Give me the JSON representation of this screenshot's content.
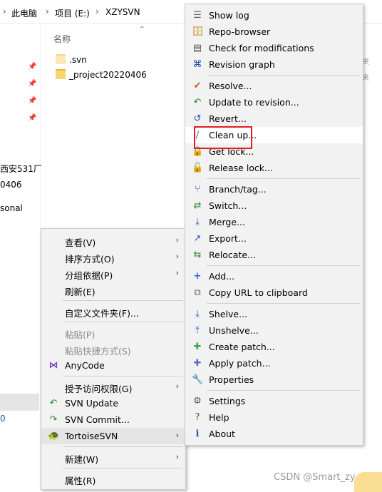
{
  "breadcrumb": [
    "此电脑",
    "项目 (E:)",
    "XZYSVN"
  ],
  "breadcrumb_sep": "›",
  "sidebar": {
    "texts": [
      "西安531厂",
      "0406",
      "sonal",
      "0"
    ],
    "pin_icon": "pin-icon"
  },
  "content": {
    "column_header": "名称",
    "files": [
      ".svn",
      "_project20220406"
    ],
    "right_stubs": [
      "夹",
      "夹"
    ]
  },
  "explorer_menu": {
    "items": [
      {
        "label": "查看(V)",
        "arrow": "›"
      },
      {
        "label": "排序方式(O)",
        "arrow": "›"
      },
      {
        "label": "分组依据(P)",
        "arrow": "›"
      },
      {
        "label": "刷新(E)"
      },
      {
        "label": "自定义文件夹(F)..."
      },
      {
        "label": "粘贴(P)",
        "disabled": true
      },
      {
        "label": "粘贴快捷方式(S)",
        "disabled": true
      },
      {
        "label": "AnyCode",
        "icon": "visual-studio-icon"
      },
      {
        "label": "授予访问权限(G)",
        "arrow": "›"
      },
      {
        "label": "SVN Update",
        "icon": "svn-update-icon"
      },
      {
        "label": "SVN Commit...",
        "icon": "svn-commit-icon"
      },
      {
        "label": "TortoiseSVN",
        "icon": "tortoise-icon",
        "arrow": "›"
      },
      {
        "label": "新建(W)",
        "arrow": "›"
      },
      {
        "label": "属性(R)"
      }
    ]
  },
  "tortoise_menu": {
    "items": [
      {
        "label": "Show log",
        "icon": "log-icon"
      },
      {
        "label": "Repo-browser",
        "icon": "repo-browser-icon"
      },
      {
        "label": "Check for modifications",
        "icon": "check-modifications-icon"
      },
      {
        "label": "Revision graph",
        "icon": "revision-graph-icon"
      },
      {
        "label": "Resolve...",
        "icon": "resolve-icon"
      },
      {
        "label": "Update to revision...",
        "icon": "update-revision-icon"
      },
      {
        "label": "Revert...",
        "icon": "revert-icon"
      },
      {
        "label": "Clean up...",
        "icon": "cleanup-icon"
      },
      {
        "label": "Get lock...",
        "icon": "get-lock-icon"
      },
      {
        "label": "Release lock...",
        "icon": "release-lock-icon"
      },
      {
        "label": "Branch/tag...",
        "icon": "branch-icon"
      },
      {
        "label": "Switch...",
        "icon": "switch-icon"
      },
      {
        "label": "Merge...",
        "icon": "merge-icon"
      },
      {
        "label": "Export...",
        "icon": "export-icon"
      },
      {
        "label": "Relocate...",
        "icon": "relocate-icon"
      },
      {
        "label": "Add...",
        "icon": "add-icon"
      },
      {
        "label": "Copy URL to clipboard",
        "icon": "copy-url-icon"
      },
      {
        "label": "Shelve...",
        "icon": "shelve-icon"
      },
      {
        "label": "Unshelve...",
        "icon": "unshelve-icon"
      },
      {
        "label": "Create patch...",
        "icon": "create-patch-icon"
      },
      {
        "label": "Apply patch...",
        "icon": "apply-patch-icon"
      },
      {
        "label": "Properties",
        "icon": "properties-icon"
      },
      {
        "label": "Settings",
        "icon": "settings-icon"
      },
      {
        "label": "Help",
        "icon": "help-icon"
      },
      {
        "label": "About",
        "icon": "about-icon"
      }
    ]
  },
  "watermark": "CSDN @Smart_zy",
  "colors": {
    "menu_bg": "#f2f2f2",
    "highlight_box": "#e02020",
    "folder": "#f7d774"
  }
}
